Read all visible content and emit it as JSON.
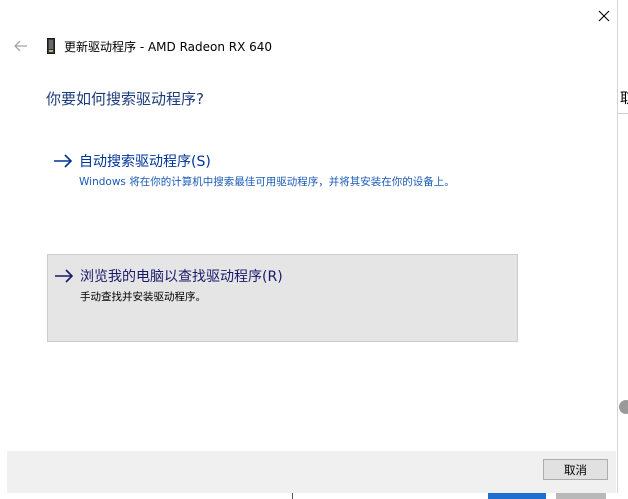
{
  "window": {
    "title": "更新驱动程序 - AMD Radeon RX 640",
    "close_icon": "close-icon",
    "back_icon": "back-arrow-icon",
    "device_icon": "display-adapter-icon"
  },
  "main": {
    "heading": "你要如何搜索驱动程序?",
    "options": [
      {
        "title": "自动搜索驱动程序(S)",
        "description": "Windows 将在你的计算机中搜索最佳可用驱动程序，并将其安装在你的设备上。",
        "icon": "right-arrow-icon"
      },
      {
        "title": "浏览我的电脑以查找驱动程序(R)",
        "description": "手动查找并安装驱动程序。",
        "icon": "right-arrow-icon",
        "state": "hover"
      }
    ]
  },
  "footer": {
    "cancel_label": "取消"
  },
  "background": {
    "partial_char": "取"
  },
  "colors": {
    "heading": "#1c3c7c",
    "link": "#003399",
    "hover_bg": "#e5e5e5",
    "footer_bg": "#f0f0f0"
  }
}
